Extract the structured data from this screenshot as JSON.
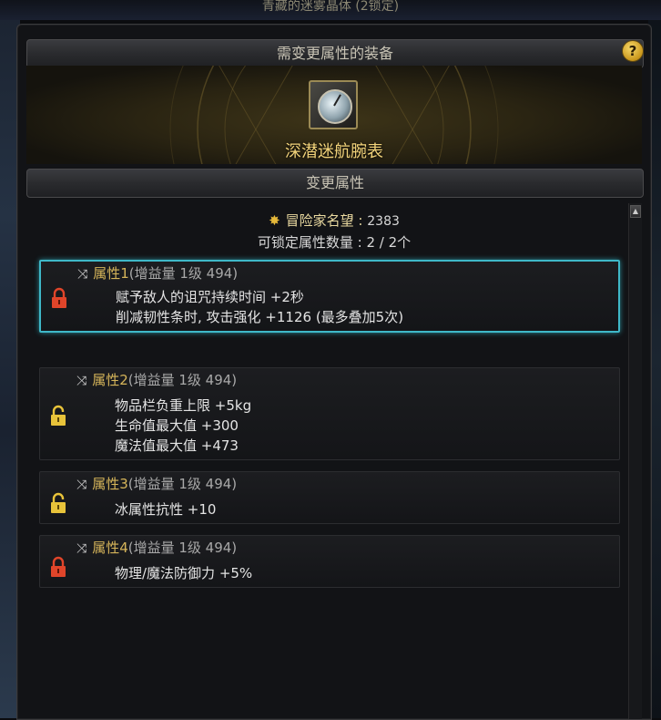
{
  "window": {
    "title": "青藏的迷雾晶体 (2锁定)"
  },
  "equip_section": {
    "header": "需变更属性的装备",
    "item_name": "深潜迷航腕表",
    "help_icon": "question-icon"
  },
  "change_section": {
    "header": "变更属性"
  },
  "reputation": {
    "label": "冒险家名望 :",
    "value": "2383",
    "icon": "reputation-icon"
  },
  "lock_count": {
    "text": "可锁定属性数量 :  2 / 2个"
  },
  "attributes": [
    {
      "label": "属性1",
      "detail": "(增益量 1级 494)",
      "locked": true,
      "lock_color": "#e0452a",
      "lines": [
        "赋予敌人的诅咒持续时间 +2秒",
        "削减韧性条时, 攻击强化 +1126 (最多叠加5次)"
      ]
    },
    {
      "label": "属性2",
      "detail": "(增益量 1级 494)",
      "locked": false,
      "lock_color": "#e8c33a",
      "lines": [
        "物品栏负重上限 +5kg",
        "生命值最大值 +300",
        "魔法值最大值 +473"
      ]
    },
    {
      "label": "属性3",
      "detail": "(增益量 1级 494)",
      "locked": false,
      "lock_color": "#e8c33a",
      "lines": [
        "冰属性抗性 +10"
      ]
    },
    {
      "label": "属性4",
      "detail": "(增益量 1级 494)",
      "locked": true,
      "lock_color": "#e0452a",
      "lines": [
        "物理/魔法防御力 +5%"
      ]
    }
  ],
  "colors": {
    "accent_gold": "#f2d37a",
    "selected_border": "#3fb8c8"
  }
}
